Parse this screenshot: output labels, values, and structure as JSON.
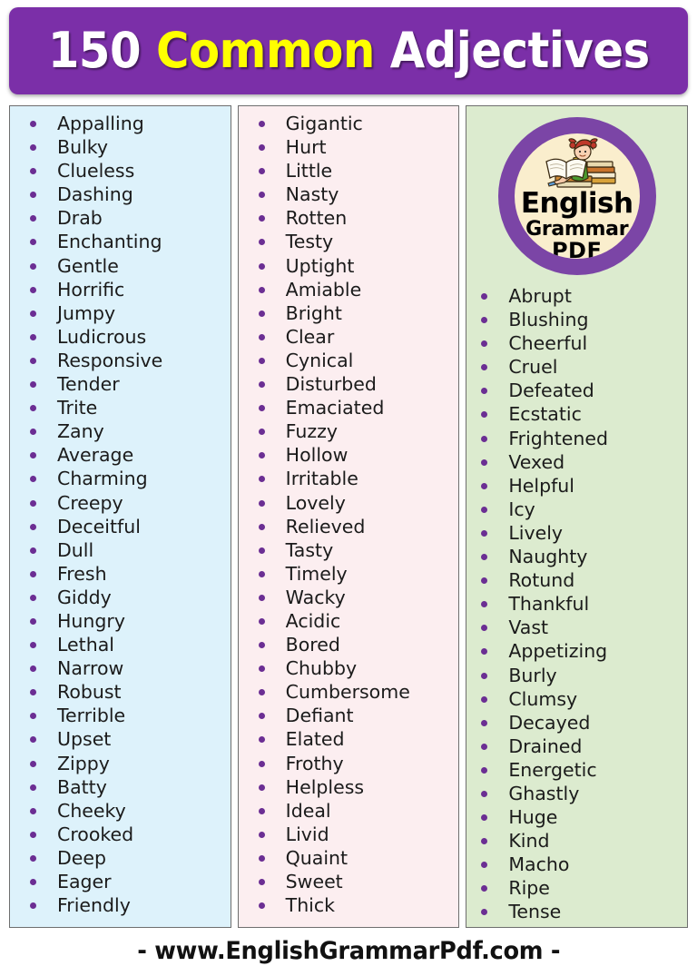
{
  "header": {
    "part1": "150 ",
    "part2": "Common",
    "part3": " Adjectives",
    "bg_color": "#7b2fa8",
    "highlight_color": "#ffff00"
  },
  "logo": {
    "line1": "English",
    "line2": "Grammar",
    "line3": "PDF",
    "ring_color": "#7b45a6",
    "face_color": "#faeecd"
  },
  "columns": [
    {
      "name": "column-1",
      "bg_color": "#ddf2fb",
      "has_logo": false,
      "words": [
        "Appalling",
        "Bulky",
        "Clueless",
        "Dashing",
        "Drab",
        "Enchanting",
        "Gentle",
        "Horrific",
        "Jumpy",
        "Ludicrous",
        "Responsive",
        "Tender",
        "Trite",
        "Zany",
        "Average",
        "Charming",
        "Creepy",
        "Deceitful",
        "Dull",
        "Fresh",
        "Giddy",
        "Hungry",
        "Lethal",
        "Narrow",
        "Robust",
        "Terrible",
        "Upset",
        "Zippy",
        "Batty",
        "Cheeky",
        "Crooked",
        "Deep",
        "Eager",
        "Friendly"
      ]
    },
    {
      "name": "column-2",
      "bg_color": "#fceef0",
      "has_logo": false,
      "words": [
        "Gigantic",
        "Hurt",
        "Little",
        "Nasty",
        "Rotten",
        "Testy",
        "Uptight",
        "Amiable",
        "Bright",
        "Clear",
        "Cynical",
        "Disturbed",
        "Emaciated",
        "Fuzzy",
        "Hollow",
        "Irritable",
        "Lovely",
        "Relieved",
        "Tasty",
        "Timely",
        "Wacky",
        "Acidic",
        "Bored",
        "Chubby",
        "Cumbersome",
        "Defiant",
        "Elated",
        "Frothy",
        "Helpless",
        "Ideal",
        "Livid",
        "Quaint",
        "Sweet",
        "Thick"
      ]
    },
    {
      "name": "column-3",
      "bg_color": "#dcebcf",
      "has_logo": true,
      "words": [
        "Abrupt",
        "Blushing",
        "Cheerful",
        "Cruel",
        "Defeated",
        "Ecstatic",
        "Frightened",
        "Vexed",
        "Helpful",
        "Icy",
        "Lively",
        "Naughty",
        "Rotund",
        "Thankful",
        "Vast",
        "Appetizing",
        "Burly",
        "Clumsy",
        "Decayed",
        "Drained",
        "Energetic",
        "Ghastly",
        "Huge",
        "Kind",
        "Macho",
        "Ripe",
        "Tense"
      ]
    }
  ],
  "footer": {
    "text": "-  www.EnglishGrammarPdf.com  -"
  }
}
